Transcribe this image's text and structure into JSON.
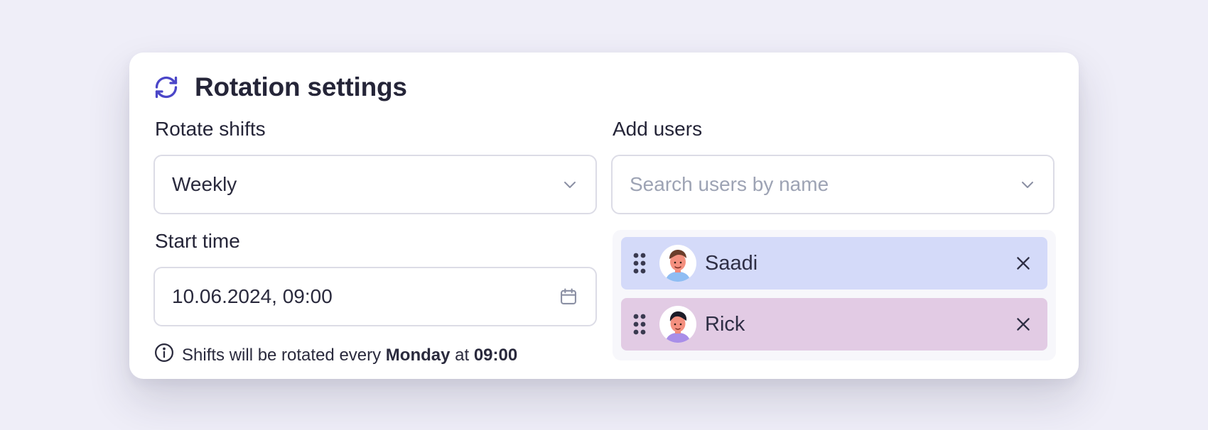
{
  "header": {
    "title": "Rotation settings",
    "icon": "refresh-icon",
    "accent": "#4b46c8"
  },
  "rotate": {
    "label": "Rotate shifts",
    "value": "Weekly"
  },
  "start": {
    "label": "Start time",
    "value": "10.06.2024, 09:00"
  },
  "hint": {
    "prefix": "Shifts will be rotated every",
    "day": "Monday",
    "middle": "at",
    "time": "09:00"
  },
  "users": {
    "label": "Add users",
    "placeholder": "Search users by name",
    "items": [
      {
        "name": "Saadi",
        "color": "#d4daf9"
      },
      {
        "name": "Rick",
        "color": "#e2cbe4"
      }
    ]
  }
}
